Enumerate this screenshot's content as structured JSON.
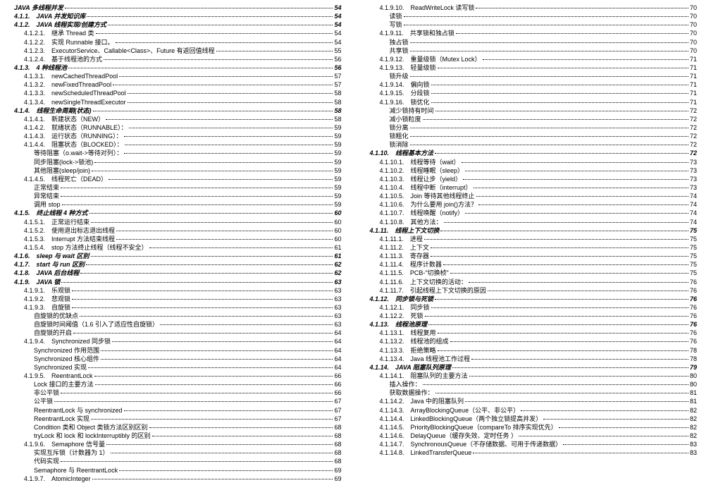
{
  "left": [
    {
      "t": "JAVA 多线程并发",
      "p": "54",
      "c": "b i1"
    },
    {
      "t": "4.1.1.　JAVA 并发知识库",
      "p": "54",
      "c": "b i1"
    },
    {
      "t": "4.1.2.　JAVA 线程实现/创建方式",
      "p": "54",
      "c": "b i1"
    },
    {
      "t": "4.1.2.1.　继承 Thread 类",
      "p": "54",
      "c": "i2"
    },
    {
      "t": "4.1.2.2.　实现 Runnable 接口。",
      "p": "54",
      "c": "i2"
    },
    {
      "t": "4.1.2.3.　ExecutorService、Callable<Class>、Future 有返回值线程",
      "p": "55",
      "c": "i2"
    },
    {
      "t": "4.1.2.4.　基于线程池的方式",
      "p": "56",
      "c": "i2"
    },
    {
      "t": "4.1.3.　4 种线程池",
      "p": "56",
      "c": "b i1"
    },
    {
      "t": "4.1.3.1.　newCachedThreadPool",
      "p": "57",
      "c": "i2"
    },
    {
      "t": "4.1.3.2.　newFixedThreadPool",
      "p": "57",
      "c": "i2"
    },
    {
      "t": "4.1.3.3.　newScheduledThreadPool",
      "p": "58",
      "c": "i2"
    },
    {
      "t": "4.1.3.4.　newSingleThreadExecutor",
      "p": "58",
      "c": "i2"
    },
    {
      "t": "4.1.4.　线程生命周期(状态)",
      "p": "58",
      "c": "b i1"
    },
    {
      "t": "4.1.4.1.　新建状态（NEW）",
      "p": "58",
      "c": "i2"
    },
    {
      "t": "4.1.4.2.　就绪状态（RUNNABLE）：",
      "p": "59",
      "c": "i2"
    },
    {
      "t": "4.1.4.3.　运行状态（RUNNING）：",
      "p": "59",
      "c": "i2"
    },
    {
      "t": "4.1.4.4.　阻塞状态（BLOCKED）：",
      "p": "59",
      "c": "i2"
    },
    {
      "t": "等待阻塞（o.wait->等待对列）：",
      "p": "59",
      "c": "i3"
    },
    {
      "t": "同步阻塞(lock->锁池)",
      "p": "59",
      "c": "i3"
    },
    {
      "t": "其他阻塞(sleep/join)",
      "p": "59",
      "c": "i3"
    },
    {
      "t": "4.1.4.5.　线程死亡（DEAD）",
      "p": "59",
      "c": "i2"
    },
    {
      "t": "正常结束",
      "p": "59",
      "c": "i3"
    },
    {
      "t": "异常结束",
      "p": "59",
      "c": "i3"
    },
    {
      "t": "调用 stop",
      "p": "59",
      "c": "i3"
    },
    {
      "t": "4.1.5.　终止线程 4 种方式",
      "p": "60",
      "c": "b i1"
    },
    {
      "t": "4.1.5.1.　正常运行结束",
      "p": "60",
      "c": "i2"
    },
    {
      "t": "4.1.5.2.　使用退出标志退出线程",
      "p": "60",
      "c": "i2"
    },
    {
      "t": "4.1.5.3.　Interrupt 方法结束线程",
      "p": "60",
      "c": "i2"
    },
    {
      "t": "4.1.5.4.　stop 方法终止线程（线程不安全）",
      "p": "61",
      "c": "i2"
    },
    {
      "t": "4.1.6.　sleep 与 wait 区别",
      "p": "61",
      "c": "b i1"
    },
    {
      "t": "4.1.7.　start 与 run 区别",
      "p": "62",
      "c": "b i1"
    },
    {
      "t": "4.1.8.　JAVA 后台线程",
      "p": "62",
      "c": "b i1"
    },
    {
      "t": "4.1.9.　JAVA 锁",
      "p": "63",
      "c": "b i1"
    },
    {
      "t": "4.1.9.1.　乐观锁",
      "p": "63",
      "c": "i2"
    },
    {
      "t": "4.1.9.2.　悲观锁",
      "p": "63",
      "c": "i2"
    },
    {
      "t": "4.1.9.3.　自旋锁",
      "p": "63",
      "c": "i2"
    },
    {
      "t": "自旋锁的优缺点",
      "p": "63",
      "c": "i3"
    },
    {
      "t": "自旋锁时间阈值（1.6 引入了适应性自旋锁）",
      "p": "63",
      "c": "i3"
    },
    {
      "t": "自旋锁的开启",
      "p": "64",
      "c": "i3"
    },
    {
      "t": "4.1.9.4.　Synchronized 同步锁",
      "p": "64",
      "c": "i2"
    },
    {
      "t": "Synchronized 作用范围",
      "p": "64",
      "c": "i3"
    },
    {
      "t": "Synchronized 核心组件",
      "p": "64",
      "c": "i3"
    },
    {
      "t": "Synchronized 实现",
      "p": "64",
      "c": "i3"
    },
    {
      "t": "4.1.9.5.　ReentrantLock",
      "p": "66",
      "c": "i2"
    },
    {
      "t": "Lock 接口的主要方法",
      "p": "66",
      "c": "i3"
    },
    {
      "t": "非公平锁",
      "p": "66",
      "c": "i3"
    },
    {
      "t": "公平锁",
      "p": "67",
      "c": "i3"
    },
    {
      "t": "ReentrantLock 与 synchronized",
      "p": "67",
      "c": "i3"
    },
    {
      "t": "ReentrantLock 实现",
      "p": "67",
      "c": "i3"
    },
    {
      "t": "Condition 类和 Object 类锁方法区别区别",
      "p": "68",
      "c": "i3"
    },
    {
      "t": "tryLock 和 lock 和 lockInterruptibly 的区别",
      "p": "68",
      "c": "i3"
    },
    {
      "t": "4.1.9.6.　Semaphore 信号量",
      "p": "68",
      "c": "i2"
    },
    {
      "t": "实现互斥锁（计数器为 1）",
      "p": "68",
      "c": "i3"
    },
    {
      "t": "代码实现",
      "p": "68",
      "c": "i3"
    },
    {
      "t": "Semaphore 与 ReentrantLock",
      "p": "69",
      "c": "i3"
    },
    {
      "t": "4.1.9.7.　AtomicInteger",
      "p": "69",
      "c": "i2"
    }
  ],
  "right": [
    {
      "t": "4.1.9.10.　ReadWriteLock 读写锁",
      "p": "70",
      "c": "i2"
    },
    {
      "t": "读锁",
      "p": "70",
      "c": "i3"
    },
    {
      "t": "写锁",
      "p": "70",
      "c": "i3"
    },
    {
      "t": "4.1.9.11.　共享锁和独占锁",
      "p": "70",
      "c": "i2"
    },
    {
      "t": "独占锁",
      "p": "70",
      "c": "i3"
    },
    {
      "t": "共享锁",
      "p": "70",
      "c": "i3"
    },
    {
      "t": "4.1.9.12.　重量级锁（Mutex Lock）",
      "p": "71",
      "c": "i2"
    },
    {
      "t": "4.1.9.13.　轻量级锁",
      "p": "71",
      "c": "i2"
    },
    {
      "t": "锁升级",
      "p": "71",
      "c": "i3"
    },
    {
      "t": "4.1.9.14.　偏向锁",
      "p": "71",
      "c": "i2"
    },
    {
      "t": "4.1.9.15.　分段锁",
      "p": "71",
      "c": "i2"
    },
    {
      "t": "4.1.9.16.　锁优化",
      "p": "71",
      "c": "i2"
    },
    {
      "t": "减少锁持有时间",
      "p": "72",
      "c": "i3"
    },
    {
      "t": "减小锁粒度",
      "p": "72",
      "c": "i3"
    },
    {
      "t": "锁分离",
      "p": "72",
      "c": "i3"
    },
    {
      "t": "锁粗化",
      "p": "72",
      "c": "i3"
    },
    {
      "t": "锁消除",
      "p": "72",
      "c": "i3"
    },
    {
      "t": "4.1.10.　线程基本方法",
      "p": "72",
      "c": "b i1"
    },
    {
      "t": "4.1.10.1.　线程等待（wait）",
      "p": "73",
      "c": "i2"
    },
    {
      "t": "4.1.10.2.　线程睡眠（sleep）",
      "p": "73",
      "c": "i2"
    },
    {
      "t": "4.1.10.3.　线程让步（yield）",
      "p": "73",
      "c": "i2"
    },
    {
      "t": "4.1.10.4.　线程中断（interrupt）",
      "p": "73",
      "c": "i2"
    },
    {
      "t": "4.1.10.5.　Join 等待其他线程终止",
      "p": "74",
      "c": "i2"
    },
    {
      "t": "4.1.10.6.　为什么要用 join()方法？",
      "p": "74",
      "c": "i2"
    },
    {
      "t": "4.1.10.7.　线程唤醒（notify）",
      "p": "74",
      "c": "i2"
    },
    {
      "t": "4.1.10.8.　其他方法：",
      "p": "74",
      "c": "i2"
    },
    {
      "t": "4.1.11.　线程上下文切换",
      "p": "75",
      "c": "b i1"
    },
    {
      "t": "4.1.11.1.　进程",
      "p": "75",
      "c": "i2"
    },
    {
      "t": "4.1.11.2.　上下文",
      "p": "75",
      "c": "i2"
    },
    {
      "t": "4.1.11.3.　寄存器",
      "p": "75",
      "c": "i2"
    },
    {
      "t": "4.1.11.4.　程序计数器",
      "p": "75",
      "c": "i2"
    },
    {
      "t": "4.1.11.5.　PCB-\"切换桢\"",
      "p": "75",
      "c": "i2"
    },
    {
      "t": "4.1.11.6.　上下文切换的活动：",
      "p": "76",
      "c": "i2"
    },
    {
      "t": "4.1.11.7.　引起线程上下文切换的原因",
      "p": "76",
      "c": "i2"
    },
    {
      "t": "4.1.12.　同步锁与死锁",
      "p": "76",
      "c": "b i1"
    },
    {
      "t": "4.1.12.1.　同步锁",
      "p": "76",
      "c": "i2"
    },
    {
      "t": "4.1.12.2.　死锁",
      "p": "76",
      "c": "i2"
    },
    {
      "t": "4.1.13.　线程池原理",
      "p": "76",
      "c": "b i1"
    },
    {
      "t": "4.1.13.1.　线程复用",
      "p": "76",
      "c": "i2"
    },
    {
      "t": "4.1.13.2.　线程池的组成",
      "p": "76",
      "c": "i2"
    },
    {
      "t": "4.1.13.3.　拒绝策略",
      "p": "78",
      "c": "i2"
    },
    {
      "t": "4.1.13.4.　Java 线程池工作过程",
      "p": "78",
      "c": "i2"
    },
    {
      "t": "4.1.14.　JAVA 阻塞队列原理",
      "p": "79",
      "c": "b i1"
    },
    {
      "t": "4.1.14.1.　阻塞队列的主要方法",
      "p": "80",
      "c": "i2"
    },
    {
      "t": "插入操作：",
      "p": "80",
      "c": "i3"
    },
    {
      "t": "获取数据操作：",
      "p": "81",
      "c": "i3"
    },
    {
      "t": "4.1.14.2.　Java 中的阻塞队列",
      "p": "81",
      "c": "i2"
    },
    {
      "t": "4.1.14.3.　ArrayBlockingQueue（公平、非公平）",
      "p": "82",
      "c": "i2"
    },
    {
      "t": "4.1.14.4.　LinkedBlockingQueue（两个独立锁提高并发）",
      "p": "82",
      "c": "i2"
    },
    {
      "t": "4.1.14.5.　PriorityBlockingQueue（compareTo 排序实现优先）",
      "p": "82",
      "c": "i2"
    },
    {
      "t": "4.1.14.6.　DelayQueue（缓存失效、定时任务 ）",
      "p": "82",
      "c": "i2"
    },
    {
      "t": "4.1.14.7.　SynchronousQueue（不存储数据、可用于传递数据）",
      "p": "83",
      "c": "i2"
    },
    {
      "t": "4.1.14.8.　LinkedTransferQueue",
      "p": "83",
      "c": "i2"
    }
  ]
}
